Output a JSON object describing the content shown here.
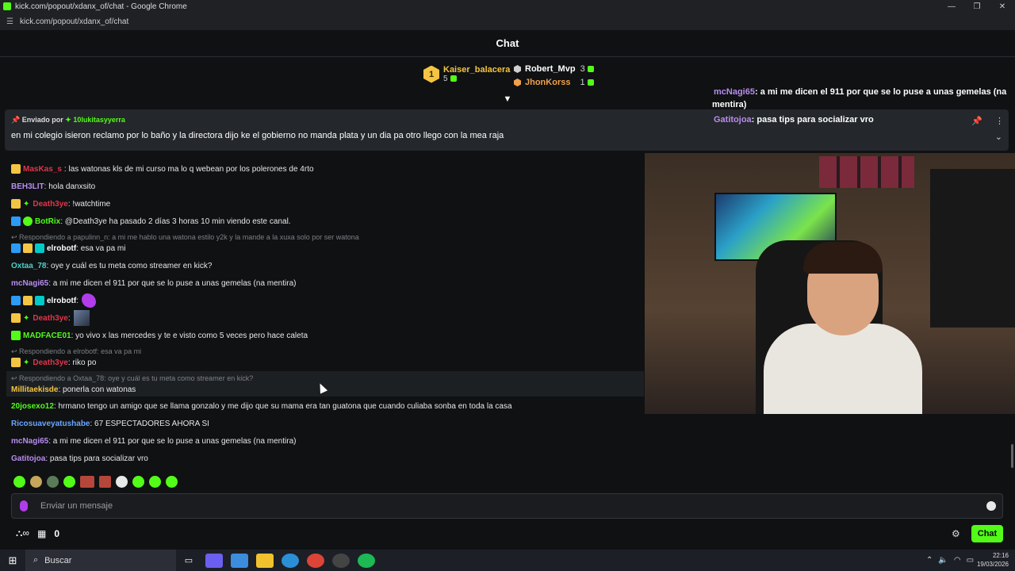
{
  "window": {
    "title": "kick.com/popout/xdanx_of/chat - Google Chrome",
    "url": "kick.com/popout/xdanx_of/chat"
  },
  "chat_header": "Chat",
  "leaderboard": {
    "first": {
      "rank": "1",
      "name": "Kaiser_balacera",
      "count": "5"
    },
    "second": {
      "name": "Robert_Mvp",
      "count": "3"
    },
    "third": {
      "name": "JhonKorss",
      "count": "1"
    }
  },
  "pinned": {
    "label_prefix": "Enviado por",
    "user": "10lukitasyyerra",
    "text": "en mi colegio isieron reclamo por lo baño y la directora dijo ke el gobierno no manda plata y un dia pa otro llego con la mea raja"
  },
  "overlay_messages": [
    {
      "user": "mcNagi65",
      "text": ": a mi me dicen el 911 por que se lo puse a unas gemelas (na",
      "color": "#b98cf0"
    },
    {
      "user": "",
      "text": "mentira)",
      "color": "#b98cf0"
    },
    {
      "user": "Gatitojoa",
      "text": ": pasa tips para socializar vro",
      "color": "#b98cf0"
    }
  ],
  "messages": [
    {
      "user": "MasKas_s",
      "text": ": las watonas kls de mi curso ma lo q webean por los polerones de 4rto",
      "color": "#e0364a"
    },
    {
      "user": "BEH3LIT",
      "text": ": hola danxsito",
      "color": "#b98cf0"
    },
    {
      "user": "Death3ye",
      "text": ": !watchtime",
      "color": "#e0364a"
    },
    {
      "user": "BotRix",
      "text": ": @Death3ye ha pasado 2 días 3 horas 10 min viendo este canal.",
      "color": "#53fc18"
    },
    {
      "reply": "Respondiendo a papulinn_n: a mi me hablo una watona estilo y2k y la mande a la xuxa solo por ser watona"
    },
    {
      "user": "elrobotf",
      "text": ": esa va pa mi",
      "color": "#ffffff"
    },
    {
      "user": "Oxtaa_78",
      "text": ": oye y cuál es tu meta como streamer en kick?",
      "color": "#4fd1c5"
    },
    {
      "user": "mcNagi65",
      "text": ": a mi me dicen el 911 por que se lo puse a unas gemelas (na mentira)",
      "color": "#b98cf0"
    },
    {
      "user": "elrobotf",
      "text": ":",
      "color": "#ffffff"
    },
    {
      "user": "Death3ye",
      "text": ":",
      "color": "#e0364a"
    },
    {
      "user": "MADFACE01",
      "text": ": yo vivo x las mercedes y te e visto como 5 veces pero hace caleta",
      "color": "#53fc18"
    },
    {
      "reply": "Respondiendo a elrobotf: esa va pa mi"
    },
    {
      "user": "Death3ye",
      "text": ": riko po",
      "color": "#e0364a"
    },
    {
      "reply": "Respondiendo a Oxtaa_78: oye y cuál es tu meta como streamer en kick?"
    },
    {
      "user": "Millitaekisde",
      "text": ": ponerla con watonas",
      "color": "#f4c542"
    },
    {
      "user": "20josexo12",
      "text": ": hrmano tengo un amigo que se llama gonzalo y me dijo que su mama era tan guatona que cuando culiaba sonba en toda la casa",
      "color": "#53fc18"
    },
    {
      "user": "Ricosuaveyatushabe",
      "text": ": 67 ESPECTADORES AHORA SI",
      "color": "#6aa6ff"
    },
    {
      "user": "mcNagi65",
      "text": ": a mi me dicen el 911 por que se lo puse a unas gemelas (na mentira)",
      "color": "#b98cf0"
    },
    {
      "user": "Gatitojoa",
      "text": ": pasa tips para socializar vro",
      "color": "#b98cf0"
    }
  ],
  "input": {
    "placeholder": "Enviar un mensaje"
  },
  "bottom": {
    "points": "0",
    "chat_button": "Chat"
  },
  "taskbar": {
    "search": "Buscar",
    "time": "22:16",
    "date": "19/03/2026"
  }
}
